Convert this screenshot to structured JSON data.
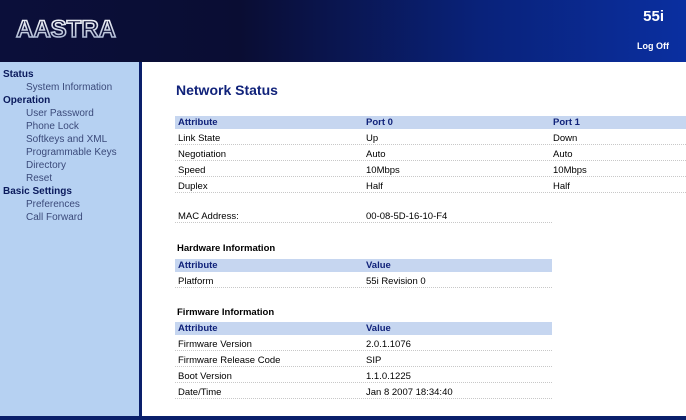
{
  "header": {
    "model": "55i",
    "logoff_label": "Log Off",
    "logo_text": "AASTRA"
  },
  "sidebar": {
    "sections": [
      {
        "label": "Status",
        "items": [
          "System Information"
        ]
      },
      {
        "label": "Operation",
        "items": [
          "User Password",
          "Phone Lock",
          "Softkeys and XML",
          "Programmable Keys",
          "Directory",
          "Reset"
        ]
      },
      {
        "label": "Basic Settings",
        "items": [
          "Preferences",
          "Call Forward"
        ]
      }
    ]
  },
  "main": {
    "title": "Network Status",
    "network": {
      "headers": [
        "Attribute",
        "Port 0",
        "Port 1"
      ],
      "rows": [
        [
          "Link State",
          "Up",
          "Down"
        ],
        [
          "Negotiation",
          "Auto",
          "Auto"
        ],
        [
          "Speed",
          "10Mbps",
          "10Mbps"
        ],
        [
          "Duplex",
          "Half",
          "Half"
        ]
      ]
    },
    "mac": {
      "label": "MAC Address:",
      "value": "00-08-5D-16-10-F4"
    },
    "hardware": {
      "heading": "Hardware Information",
      "headers": [
        "Attribute",
        "Value"
      ],
      "rows": [
        [
          "Platform",
          "55i Revision 0"
        ]
      ]
    },
    "firmware": {
      "heading": "Firmware Information",
      "headers": [
        "Attribute",
        "Value"
      ],
      "rows": [
        [
          "Firmware Version",
          "2.0.1.1076"
        ],
        [
          "Firmware Release Code",
          "SIP"
        ],
        [
          "Boot Version",
          "1.1.0.1225"
        ],
        [
          "Date/Time",
          "Jan 8 2007 18:34:40"
        ]
      ]
    }
  }
}
